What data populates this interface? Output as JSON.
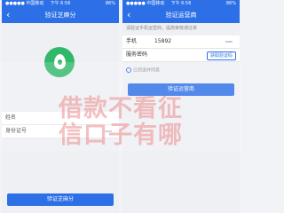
{
  "left_screen": {
    "status": {
      "carrier": "●●●●● 中国移动",
      "time": "下午 6:56",
      "battery": "86%"
    },
    "nav_title": "验证芝麻分",
    "back_icon": "chevron-left-icon",
    "logo_icon": "sesame-credit-logo-icon",
    "fields": [
      {
        "label": "姓名",
        "value": ""
      },
      {
        "label": "身份证号",
        "value": ""
      }
    ],
    "submit_label": "验证芝麻分"
  },
  "right_screen": {
    "status": {
      "carrier": "●●●●● 中国移动",
      "time": "下午 6:56",
      "battery": "86%"
    },
    "nav_title": "验证运营商",
    "back_icon": "chevron-left-icon",
    "hint": "请验证手机运营商，提高审核通过率",
    "fields": [
      {
        "label": "手机",
        "value": "15892"
      },
      {
        "label": "服务密码",
        "value": ""
      }
    ],
    "code_button": "获取验证码",
    "agree_text": "已阅读并同意",
    "submit_label": "验证运营商"
  },
  "overlay": {
    "line1": "借款不看征",
    "line2": "信口子有哪"
  },
  "colors": {
    "brand_blue": "#2c6fe6",
    "logo_green": "#31b86a"
  }
}
